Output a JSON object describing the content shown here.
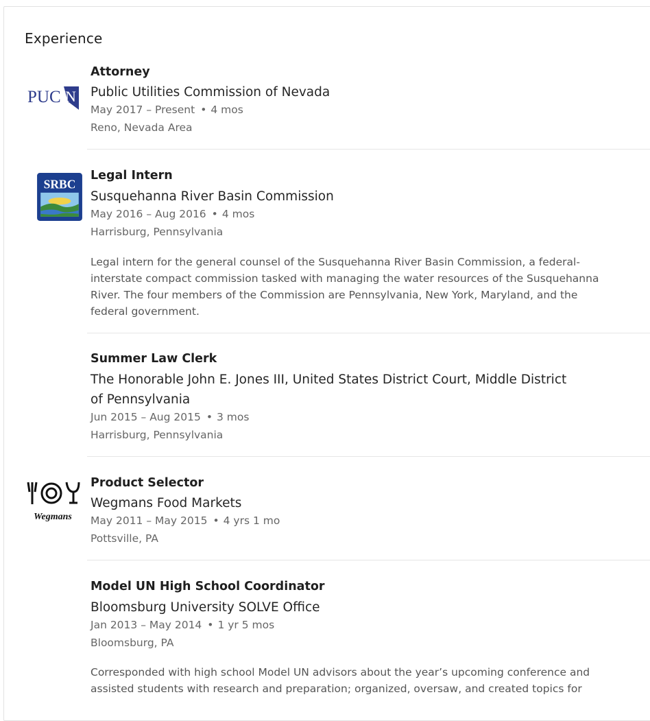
{
  "section": {
    "title": "Experience"
  },
  "entries": [
    {
      "title": "Attorney",
      "company": "Public Utilities Commission of Nevada",
      "dates": "May 2017 – Present",
      "duration": "4 mos",
      "location": "Reno, Nevada Area",
      "logo_text": "PUCN",
      "logo_color": "#2e3c8c"
    },
    {
      "title": "Legal Intern",
      "company": "Susquehanna River Basin Commission",
      "dates": "May 2016 – Aug 2016",
      "duration": "4 mos",
      "location": "Harrisburg, Pennsylvania",
      "description": "Legal intern for the general counsel of the Susquehanna River Basin Commission, a federal-interstate compact commission tasked with managing the water resources of the Susquehanna River. The four members of the Commission are Pennsylvania, New York, Maryland, and the federal government.",
      "logo_text": "SRBC",
      "logo_color": "#1c3f8f"
    },
    {
      "title": "Summer Law Clerk",
      "company": "The Honorable John E. Jones III, United States District Court, Middle District of Pennsylvania",
      "dates": "Jun 2015 – Aug 2015",
      "duration": "3 mos",
      "location": "Harrisburg, Pennsylvania"
    },
    {
      "title": "Product Selector",
      "company": "Wegmans Food Markets",
      "dates": "May 2011 – May 2015",
      "duration": "4 yrs 1 mo",
      "location": "Pottsville, PA",
      "logo_text": "Wegmans"
    },
    {
      "title": "Model UN High School Coordinator",
      "company": "Bloomsburg University SOLVE Office",
      "dates": "Jan 2013 – May 2014",
      "duration": "1 yr 5 mos",
      "location": "Bloomsburg, PA",
      "description": "Corresponded with high school Model UN advisors about the year’s upcoming conference and assisted students with research and preparation; organized, oversaw, and created topics for"
    }
  ]
}
